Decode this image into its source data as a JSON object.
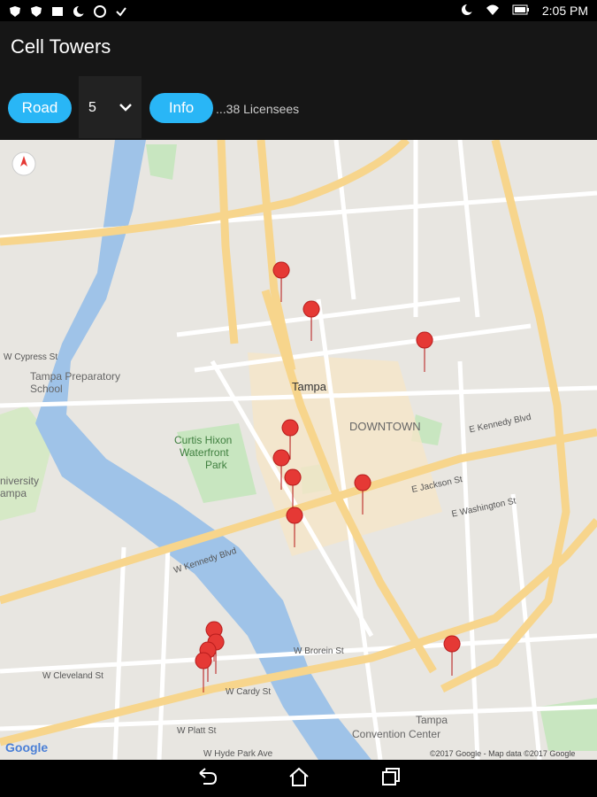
{
  "status": {
    "time": "2:05 PM"
  },
  "app": {
    "title": "Cell Towers"
  },
  "toolbar": {
    "road_label": "Road",
    "zoom_value": "5",
    "info_label": "Info",
    "licensees_text": "...38 Licensees"
  },
  "map": {
    "labels": {
      "downtown": "DOWNTOWN",
      "tampa": "Tampa",
      "prep_school_1": "Tampa Preparatory",
      "prep_school_2": "School",
      "park_1": "Curtis Hixon",
      "park_2": "Waterfront",
      "park_3": "Park",
      "university_1": "niversity",
      "university_2": "ampa",
      "convention_1": "Tampa",
      "convention_2": "Convention Center",
      "kennedy": "W Kennedy Blvd",
      "e_kennedy": "E Kennedy Blvd",
      "cleveland": "W Cleveland St",
      "cardy": "W Cardy St",
      "platt": "W Platt St",
      "hyde": "W Hyde Park Ave",
      "jackson": "E Jackson St",
      "washington": "E Washington St",
      "brorein": "W Brorein St",
      "cypress": "W Cypress St",
      "google": "Google",
      "copyright": "©2017 Google - Map data ©2017 Google"
    },
    "pin_color": "#e53935",
    "pins_count": 13
  },
  "nav": {
    "back_icon": "back-icon",
    "home_icon": "home-icon",
    "recents_icon": "recents-icon"
  }
}
